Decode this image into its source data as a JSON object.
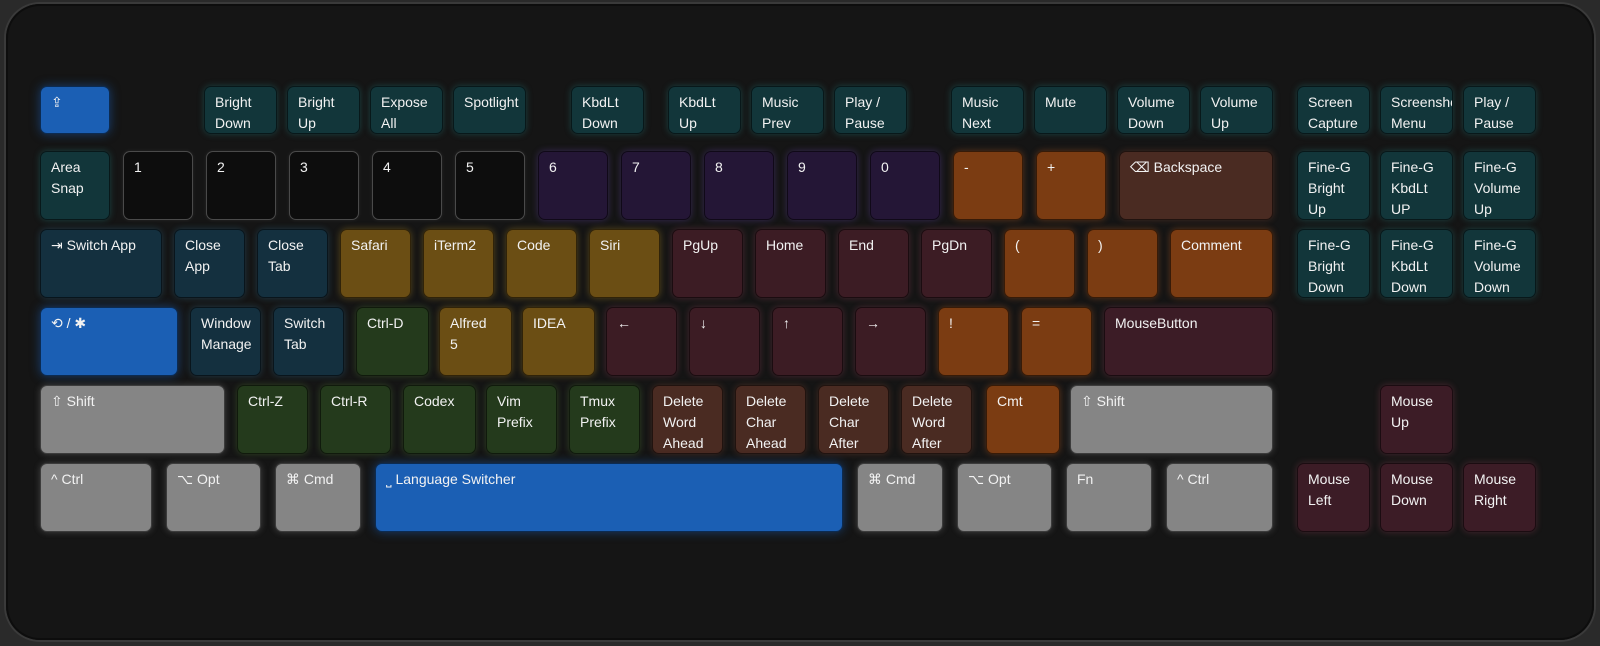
{
  "keyboard": {
    "rows": [
      [
        {
          "id": "shift-lock-key",
          "label": "⇪",
          "color": "blue"
        },
        {
          "id": "bright-down-key",
          "label": "Bright\nDown",
          "color": "teal"
        },
        {
          "id": "bright-up-key",
          "label": "Bright\nUp",
          "color": "teal"
        },
        {
          "id": "expose-all-key",
          "label": "Expose\nAll",
          "color": "teal"
        },
        {
          "id": "spotlight-key",
          "label": "Spotlight",
          "color": "teal"
        },
        {
          "id": "kbdlt-down-key",
          "label": "KbdLt\nDown",
          "color": "teal"
        },
        {
          "id": "kbdlt-up-key",
          "label": "KbdLt\nUp",
          "color": "teal"
        },
        {
          "id": "music-prev-key",
          "label": "Music\nPrev",
          "color": "teal"
        },
        {
          "id": "play-pause-key",
          "label": "Play /\nPause",
          "color": "teal"
        },
        {
          "id": "music-next-key",
          "label": "Music\nNext",
          "color": "teal"
        },
        {
          "id": "mute-key",
          "label": "Mute",
          "color": "teal"
        },
        {
          "id": "volume-down-key",
          "label": "Volume\nDown",
          "color": "teal"
        },
        {
          "id": "volume-up-key",
          "label": "Volume\nUp",
          "color": "teal"
        },
        {
          "id": "screen-capture-key",
          "label": "Screen\nCapture",
          "color": "teal"
        },
        {
          "id": "screenshot-menu-key",
          "label": "Screenshot\nMenu",
          "color": "teal"
        },
        {
          "id": "play-pause-right-key",
          "label": "Play /\nPause",
          "color": "teal"
        }
      ],
      [
        {
          "id": "area-snap-key",
          "label": "Area\nSnap",
          "color": "teal"
        },
        {
          "id": "key-1",
          "label": "1",
          "color": "black"
        },
        {
          "id": "key-2",
          "label": "2",
          "color": "black"
        },
        {
          "id": "key-3",
          "label": "3",
          "color": "black"
        },
        {
          "id": "key-4",
          "label": "4",
          "color": "black"
        },
        {
          "id": "key-5",
          "label": "5",
          "color": "black"
        },
        {
          "id": "key-6",
          "label": "6",
          "color": "purple"
        },
        {
          "id": "key-7",
          "label": "7",
          "color": "purple"
        },
        {
          "id": "key-8",
          "label": "8",
          "color": "purple"
        },
        {
          "id": "key-9",
          "label": "9",
          "color": "purple"
        },
        {
          "id": "key-0",
          "label": "0",
          "color": "purple"
        },
        {
          "id": "minus-key",
          "label": "-",
          "color": "orange"
        },
        {
          "id": "plus-key",
          "label": "+",
          "color": "orange"
        },
        {
          "id": "backspace-key",
          "label": "⌫ Backspace",
          "color": "brown"
        },
        {
          "id": "fine-g-bright-up-key",
          "label": "Fine-G\nBright\nUp",
          "color": "teal"
        },
        {
          "id": "fine-g-kbdlt-up-key",
          "label": "Fine-G\nKbdLt\nUP",
          "color": "teal"
        },
        {
          "id": "fine-g-volume-up-key",
          "label": "Fine-G\nVolume\nUp",
          "color": "teal"
        }
      ],
      [
        {
          "id": "switch-app-key",
          "label": "⇥ Switch App",
          "color": "navy"
        },
        {
          "id": "close-app-key",
          "label": "Close\nApp",
          "color": "navy"
        },
        {
          "id": "close-tab-key",
          "label": "Close\nTab",
          "color": "navy"
        },
        {
          "id": "safari-key",
          "label": "Safari",
          "color": "gold"
        },
        {
          "id": "iterm2-key",
          "label": "iTerm2",
          "color": "gold"
        },
        {
          "id": "code-key",
          "label": "Code",
          "color": "gold"
        },
        {
          "id": "siri-key",
          "label": "Siri",
          "color": "gold"
        },
        {
          "id": "pgup-key",
          "label": "PgUp",
          "color": "maroon"
        },
        {
          "id": "home-key",
          "label": "Home",
          "color": "maroon"
        },
        {
          "id": "end-key",
          "label": "End",
          "color": "maroon"
        },
        {
          "id": "pgdn-key",
          "label": "PgDn",
          "color": "maroon"
        },
        {
          "id": "paren-open-key",
          "label": "(",
          "color": "orange"
        },
        {
          "id": "paren-close-key",
          "label": ")",
          "color": "orange"
        },
        {
          "id": "comment-key",
          "label": "Comment",
          "color": "orange"
        },
        {
          "id": "fine-g-bright-down-key",
          "label": "Fine-G\nBright\nDown",
          "color": "teal"
        },
        {
          "id": "fine-g-kbdlt-down-key",
          "label": "Fine-G\nKbdLt\nDown",
          "color": "teal"
        },
        {
          "id": "fine-g-volume-down-key",
          "label": "Fine-G\nVolume\nDown",
          "color": "teal"
        }
      ],
      [
        {
          "id": "lock-star-key",
          "label": "⟲ / ✱",
          "color": "blue"
        },
        {
          "id": "window-manage-key",
          "label": "Window\nManage",
          "color": "navy"
        },
        {
          "id": "switch-tab-key",
          "label": "Switch\nTab",
          "color": "navy"
        },
        {
          "id": "ctrl-d-key",
          "label": "Ctrl-D",
          "color": "green"
        },
        {
          "id": "alfred-key",
          "label": "Alfred\n5",
          "color": "gold"
        },
        {
          "id": "idea-key",
          "label": "IDEA",
          "color": "gold"
        },
        {
          "id": "arrow-left-key",
          "label": "←",
          "color": "maroon"
        },
        {
          "id": "arrow-down-key",
          "label": "↓",
          "color": "maroon"
        },
        {
          "id": "arrow-up-key",
          "label": "↑",
          "color": "maroon"
        },
        {
          "id": "arrow-right-key",
          "label": "→",
          "color": "maroon"
        },
        {
          "id": "exclaim-key",
          "label": "!",
          "color": "orange"
        },
        {
          "id": "equals-key",
          "label": "=",
          "color": "orange"
        },
        {
          "id": "mouse-button-key",
          "label": "MouseButton",
          "color": "mauve"
        }
      ],
      [
        {
          "id": "left-shift-key",
          "label": "⇧ Shift",
          "color": "gray"
        },
        {
          "id": "ctrl-z-key",
          "label": "Ctrl-Z",
          "color": "green"
        },
        {
          "id": "ctrl-r-key",
          "label": "Ctrl-R",
          "color": "green"
        },
        {
          "id": "codex-key",
          "label": "Codex",
          "color": "green"
        },
        {
          "id": "vim-prefix-key",
          "label": "Vim\nPrefix",
          "color": "green"
        },
        {
          "id": "tmux-prefix-key",
          "label": "Tmux\nPrefix",
          "color": "green"
        },
        {
          "id": "delete-word-ahead-key",
          "label": "Delete\nWord\nAhead",
          "color": "brown"
        },
        {
          "id": "delete-char-ahead-key",
          "label": "Delete\nChar\nAhead",
          "color": "brown"
        },
        {
          "id": "delete-char-after-key",
          "label": "Delete\nChar\nAfter",
          "color": "brown"
        },
        {
          "id": "delete-word-after-key",
          "label": "Delete\nWord\nAfter",
          "color": "brown"
        },
        {
          "id": "cmt-key",
          "label": "Cmt",
          "color": "orange"
        },
        {
          "id": "right-shift-key",
          "label": "⇧ Shift",
          "color": "gray"
        },
        {
          "id": "mouse-up-key",
          "label": "Mouse\nUp",
          "color": "mauve"
        }
      ],
      [
        {
          "id": "left-ctrl-key",
          "label": "^ Ctrl",
          "color": "gray"
        },
        {
          "id": "left-opt-key",
          "label": "⌥ Opt",
          "color": "gray"
        },
        {
          "id": "left-cmd-key",
          "label": "⌘ Cmd",
          "color": "gray"
        },
        {
          "id": "language-switcher-key",
          "label": "⎵ Language Switcher",
          "color": "blue"
        },
        {
          "id": "right-cmd-key",
          "label": "⌘ Cmd",
          "color": "gray"
        },
        {
          "id": "right-opt-key",
          "label": "⌥ Opt",
          "color": "gray"
        },
        {
          "id": "fn-key",
          "label": "Fn",
          "color": "gray"
        },
        {
          "id": "right-ctrl-key",
          "label": "^ Ctrl",
          "color": "gray"
        },
        {
          "id": "mouse-left-key",
          "label": "Mouse\nLeft",
          "color": "mauve"
        },
        {
          "id": "mouse-down-key",
          "label": "Mouse\nDown",
          "color": "mauve"
        },
        {
          "id": "mouse-right-key",
          "label": "Mouse\nRight",
          "color": "mauve"
        }
      ]
    ]
  }
}
